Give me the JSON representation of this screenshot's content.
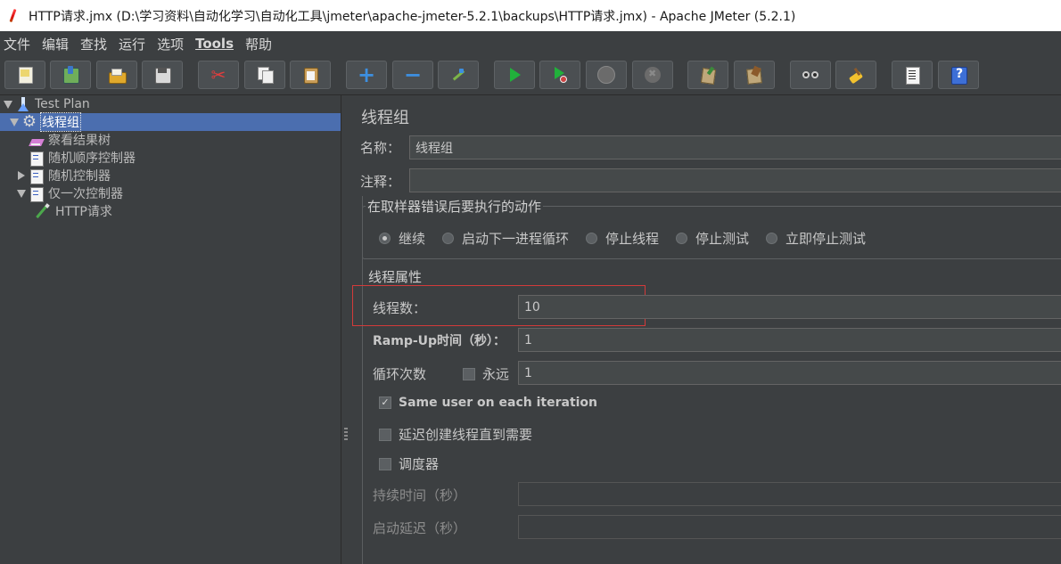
{
  "window": {
    "title": "HTTP请求.jmx (D:\\学习资料\\自动化学习\\自动化工具\\jmeter\\apache-jmeter-5.2.1\\backups\\HTTP请求.jmx) - Apache JMeter (5.2.1)"
  },
  "menu": {
    "items": [
      "文件",
      "编辑",
      "查找",
      "运行",
      "选项",
      "Tools",
      "帮助"
    ]
  },
  "toolbar": {
    "buttons": [
      "new-icon",
      "templates-icon",
      "open-icon",
      "save-icon",
      "cut-icon",
      "copy-icon",
      "paste-icon",
      "expand-icon",
      "collapse-icon",
      "toggle-icon",
      "start-icon",
      "start-no-pauses-icon",
      "stop-icon",
      "shutdown-icon",
      "clear-icon",
      "clear-all-icon",
      "search-icon",
      "reset-search-icon",
      "log-viewer-icon",
      "help-icon"
    ],
    "plus_glyph": "+",
    "minus_glyph": "−",
    "cut_glyph": "✂"
  },
  "tree": {
    "nodes": [
      {
        "label": "Test Plan"
      },
      {
        "label": "线程组"
      },
      {
        "label": "察看结果树"
      },
      {
        "label": "随机顺序控制器"
      },
      {
        "label": "随机控制器"
      },
      {
        "label": "仅一次控制器"
      },
      {
        "label": "HTTP请求"
      }
    ]
  },
  "panel": {
    "title": "线程组",
    "name_label": "名称：",
    "name_value": "线程组",
    "comment_label": "注释：",
    "comment_value": "",
    "error_action": {
      "title": "在取样器错误后要执行的动作",
      "options": [
        "继续",
        "启动下一进程循环",
        "停止线程",
        "停止测试",
        "立即停止测试"
      ],
      "selected": "继续"
    },
    "thread_props": {
      "title": "线程属性",
      "threads_label": "线程数：",
      "threads_value": "10",
      "rampup_label": "Ramp-Up时间（秒）：",
      "rampup_value": "1",
      "loop_label": "循环次数",
      "forever_label": "永远",
      "forever_checked": false,
      "loop_value": "1",
      "same_user_label": "Same user on each iteration",
      "same_user_checked": true,
      "delay_label": "延迟创建线程直到需要",
      "delay_checked": false,
      "scheduler_label": "调度器",
      "scheduler_checked": false,
      "duration_label": "持续时间（秒）",
      "duration_value": "",
      "startup_delay_label": "启动延迟（秒）",
      "startup_delay_value": ""
    }
  },
  "colors": {
    "background": "#3c3f41",
    "selection": "#4b6eaf",
    "highlight_box": "#d33a3a"
  }
}
